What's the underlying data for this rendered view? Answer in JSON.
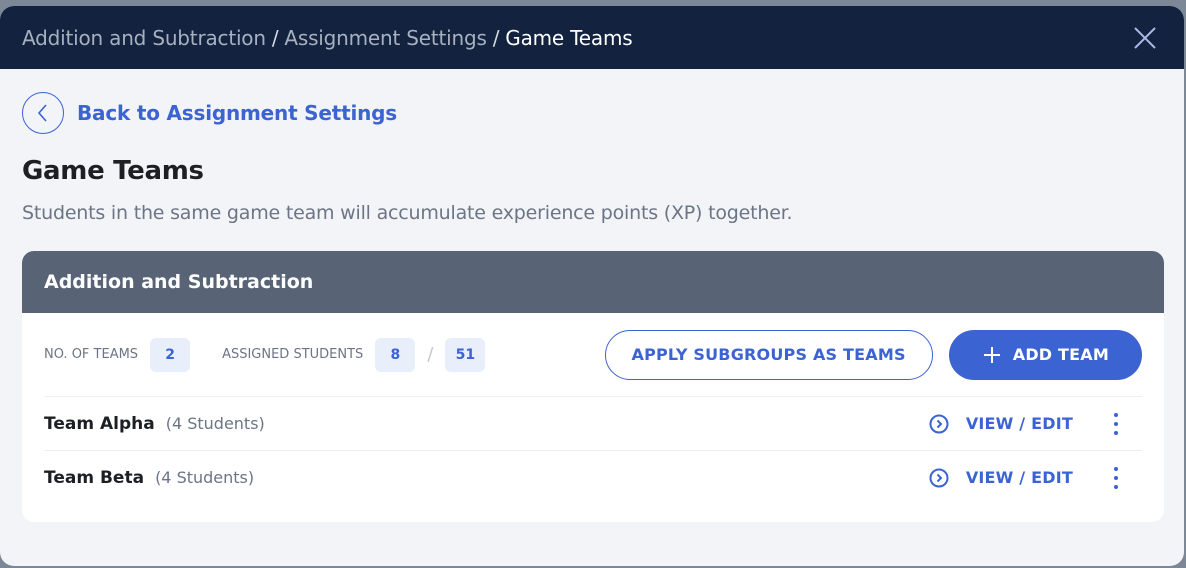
{
  "header": {
    "breadcrumbs": [
      "Addition and Subtraction",
      "Assignment Settings"
    ],
    "separator": "/",
    "current": "Game Teams",
    "close_icon": "close-icon"
  },
  "back": {
    "label": "Back to Assignment Settings",
    "icon": "chevron-left-icon"
  },
  "page": {
    "title": "Game Teams",
    "description": "Students in the same game team will accumulate experience points (XP) together."
  },
  "card": {
    "title": "Addition and Subtraction",
    "stats": {
      "teams_label": "NO. OF TEAMS",
      "teams_value": "2",
      "assigned_label": "ASSIGNED STUDENTS",
      "assigned_value": "8",
      "separator": "/",
      "total_value": "51"
    },
    "buttons": {
      "apply_subgroups": "APPLY SUBGROUPS AS TEAMS",
      "add_team": "ADD TEAM"
    },
    "teams": [
      {
        "name": "Team Alpha",
        "count": "(4 Students)",
        "action": "VIEW / EDIT"
      },
      {
        "name": "Team Beta",
        "count": "(4 Students)",
        "action": "VIEW / EDIT"
      }
    ]
  },
  "colors": {
    "header_bg": "#13233f",
    "accent": "#3b63d1",
    "card_header_bg": "#586476",
    "page_bg": "#f3f4f8"
  }
}
